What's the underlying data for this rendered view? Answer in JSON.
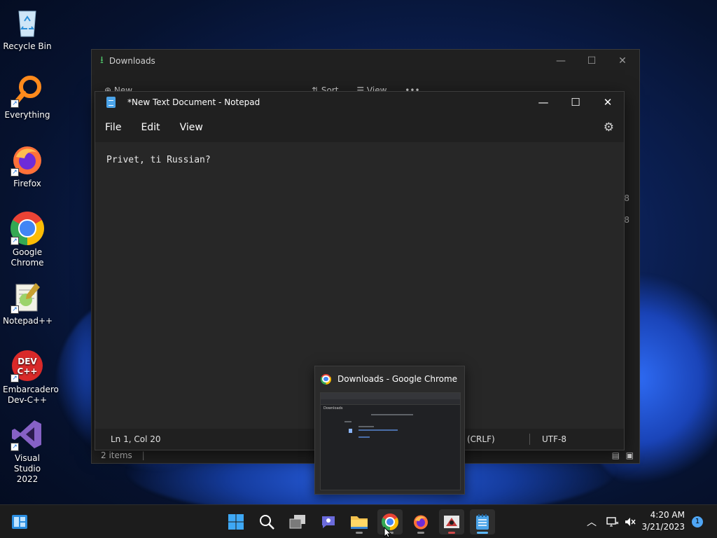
{
  "desktop": {
    "icons": [
      {
        "label": "Recycle Bin",
        "icon": "recycle-bin-icon"
      },
      {
        "label": "Everything",
        "icon": "everything-search-icon"
      },
      {
        "label": "Firefox",
        "icon": "firefox-icon"
      },
      {
        "label": "Google Chrome",
        "icon": "chrome-icon"
      },
      {
        "label": "Notepad++",
        "icon": "notepadpp-icon"
      },
      {
        "label": "Embarcadero Dev-C++",
        "icon": "devcpp-icon",
        "badge": "DEV C++"
      },
      {
        "label": "Visual Studio 2022",
        "icon": "visual-studio-icon"
      }
    ]
  },
  "explorer": {
    "title": "Downloads",
    "toolbar": {
      "new": "New",
      "sort": "Sort",
      "view": "View",
      "more": "•••"
    },
    "side_values": [
      "8",
      "8"
    ],
    "status": "2 items"
  },
  "notepad": {
    "title": "*New Text Document - Notepad",
    "menu": {
      "file": "File",
      "edit": "Edit",
      "view": "View"
    },
    "content": "Privet, ti Russian?",
    "status": {
      "position": "Ln 1, Col 20",
      "line_ending": "(CRLF)",
      "encoding": "UTF-8"
    }
  },
  "preview": {
    "title": "Downloads - Google Chrome",
    "thumb_label": "Downloads"
  },
  "taskbar": {
    "apps": [
      "widgets",
      "start",
      "search",
      "task-view",
      "chat",
      "file-explorer",
      "chrome",
      "firefox",
      "app",
      "notepad"
    ],
    "clock_time": "4:20 AM",
    "clock_date": "3/21/2023",
    "notifications": "1"
  },
  "colors": {
    "accent": "#5cb8ff",
    "title_bar": "#202020",
    "editor_bg": "#272727"
  }
}
